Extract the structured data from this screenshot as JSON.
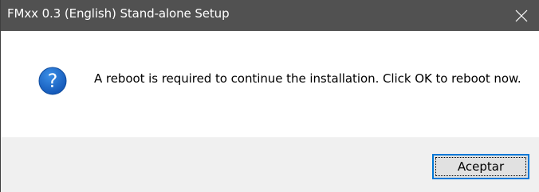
{
  "window": {
    "title": "FMxx 0.3 (English) Stand-alone Setup"
  },
  "dialog": {
    "icon": "question-icon",
    "message": "A reboot is required to continue the installation. Click OK to reboot now."
  },
  "buttons": {
    "accept_label": "Aceptar"
  },
  "colors": {
    "title_bar": "#515151",
    "title_text": "#ffffff",
    "content_bg": "#ffffff",
    "footer_bg": "#f0f0f0",
    "button_bg": "#e1e1e1",
    "button_border": "#0078d7",
    "icon_fill": "#1e6fd0"
  }
}
